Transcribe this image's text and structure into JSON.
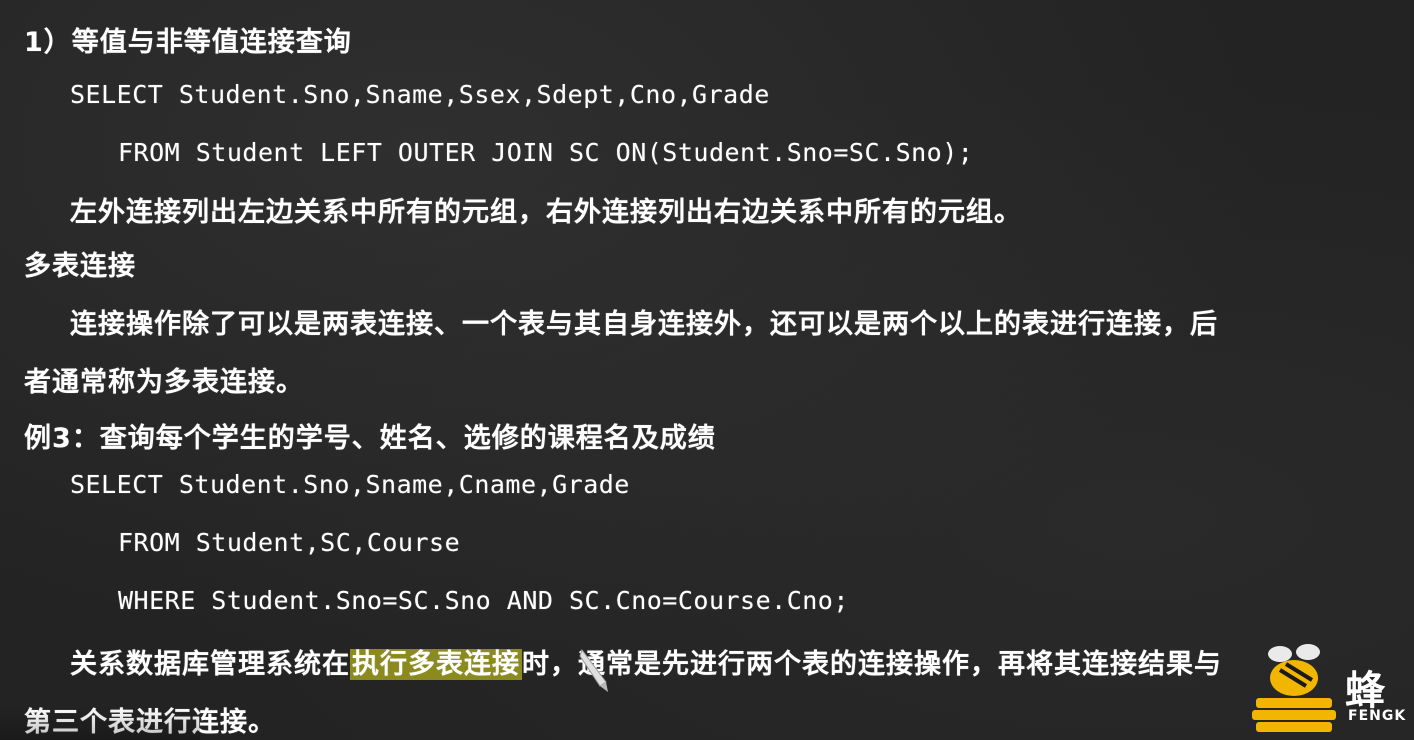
{
  "slide": {
    "lines": [
      {
        "text": "1）等值与非等值连接查询"
      },
      {
        "text": "SELECT Student.Sno,Sname,Ssex,Sdept,Cno,Grade"
      },
      {
        "text": "FROM Student LEFT OUTER JOIN SC ON(Student.Sno=SC.Sno);"
      },
      {
        "text": "左外连接列出左边关系中所有的元组，右外连接列出右边关系中所有的元组。"
      },
      {
        "text": "多表连接"
      },
      {
        "text": "连接操作除了可以是两表连接、一个表与其自身连接外，还可以是两个以上的表进行连接，后"
      },
      {
        "text": "者通常称为多表连接。"
      },
      {
        "text": "例3：查询每个学生的学号、姓名、选修的课程名及成绩"
      },
      {
        "text": "SELECT Student.Sno,Sname,Cname,Grade"
      },
      {
        "text": "FROM Student,SC,Course"
      },
      {
        "text": "WHERE Student.Sno=SC.Sno AND SC.Cno=Course.Cno;"
      }
    ],
    "last_para": {
      "before": "关系数据库管理系统在",
      "highlight": "执行多表连接",
      "after": "时，通常是先进行两个表的连接操作，再将其连接结果与"
    },
    "final_line": "第三个表进行连接。"
  },
  "logo": {
    "char": "蜂",
    "sub": "FENGK"
  },
  "colors": {
    "background": "#232323",
    "text": "#ffffff",
    "highlight": "#8a8a1e",
    "logo_yellow": "#f2b600"
  }
}
